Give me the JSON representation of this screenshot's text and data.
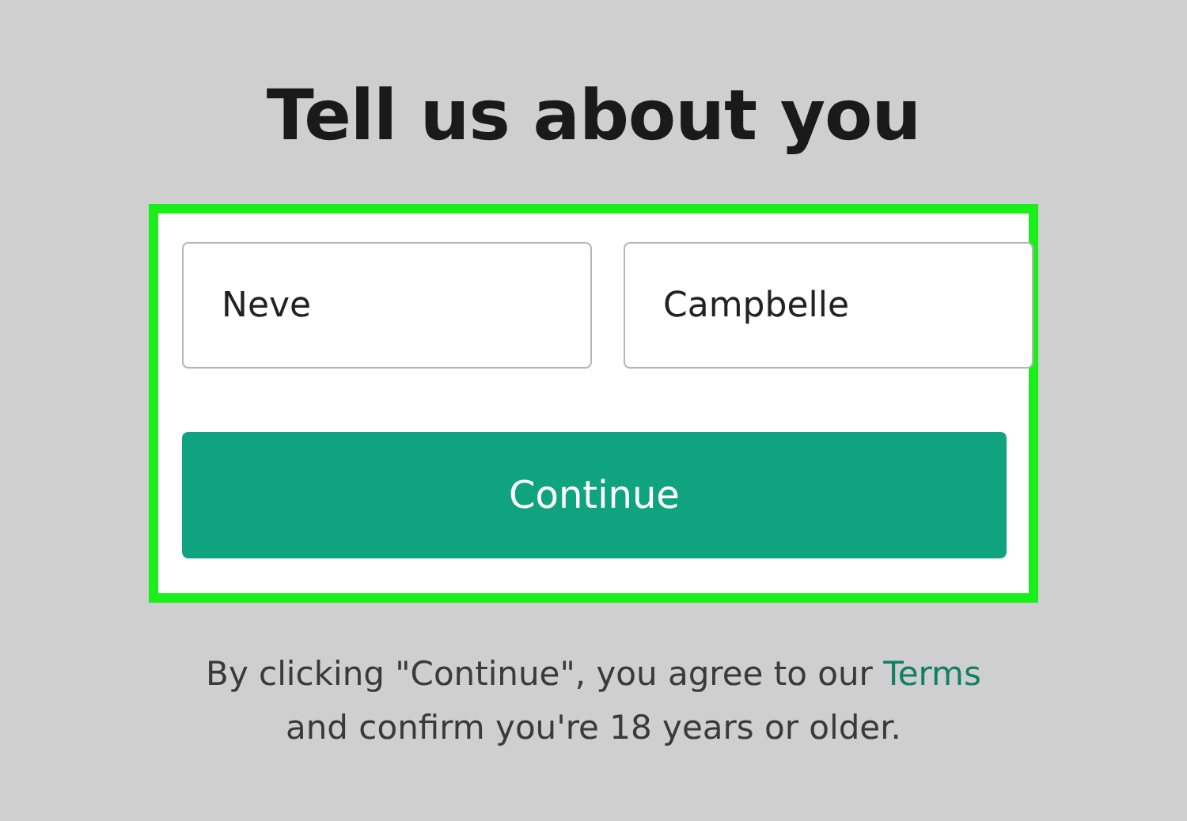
{
  "heading": "Tell us about you",
  "fields": [
    {
      "value": "Neve"
    },
    {
      "value": "Campbelle"
    }
  ],
  "button": "Continue",
  "legal": {
    "before": "By clicking \"Continue\", you agree to our ",
    "link": "Terms",
    "after": "and confirm you're 18 years or older."
  }
}
